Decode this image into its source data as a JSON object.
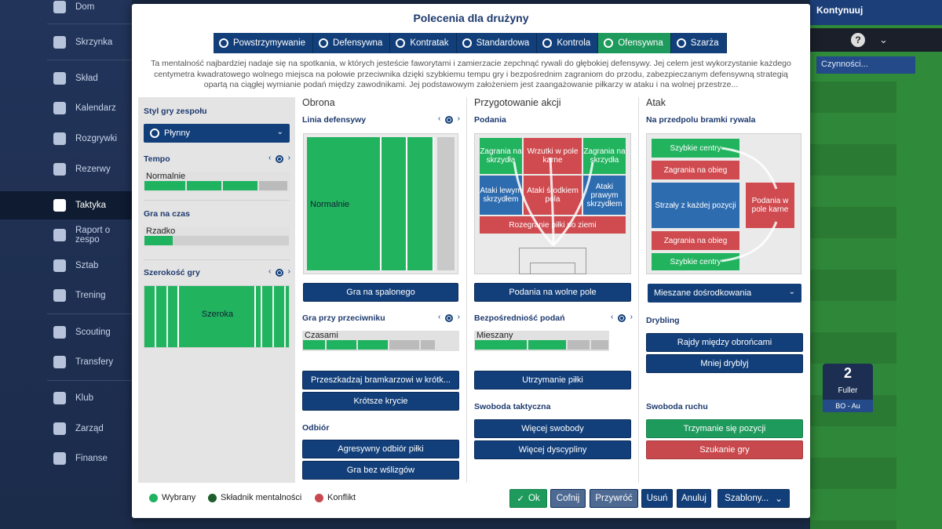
{
  "sidebar": {
    "items": [
      {
        "label": "Dom",
        "icon": "home-icon"
      },
      {
        "label": "Skrzynka",
        "icon": "inbox-icon"
      },
      {
        "label": "Skład",
        "icon": "squad-icon"
      },
      {
        "label": "Kalendarz",
        "icon": "calendar-icon"
      },
      {
        "label": "Rozgrywki",
        "icon": "trophy-icon"
      },
      {
        "label": "Rezerwy",
        "icon": "reserves-icon"
      },
      {
        "label": "Taktyka",
        "icon": "tactics-icon"
      },
      {
        "label": "Raport o zespo",
        "icon": "report-icon"
      },
      {
        "label": "Sztab",
        "icon": "staff-icon"
      },
      {
        "label": "Trening",
        "icon": "training-icon"
      },
      {
        "label": "Scouting",
        "icon": "search-icon"
      },
      {
        "label": "Transfery",
        "icon": "transfer-icon"
      },
      {
        "label": "Klub",
        "icon": "club-icon"
      },
      {
        "label": "Zarząd",
        "icon": "board-icon"
      },
      {
        "label": "Finanse",
        "icon": "finance-icon"
      }
    ],
    "active": "Taktyka"
  },
  "topbar": {
    "continue_label": "Kontynuuj",
    "help": "?",
    "actions_label": "Czynności..."
  },
  "player_card": {
    "number": "2",
    "name": "Fuller",
    "position": "BO - Au"
  },
  "modal": {
    "title": "Polecenia dla drużyny",
    "mentalities": [
      {
        "label": "Powstrzymywanie",
        "active": false
      },
      {
        "label": "Defensywna",
        "active": false
      },
      {
        "label": "Kontratak",
        "active": false
      },
      {
        "label": "Standardowa",
        "active": false
      },
      {
        "label": "Kontrola",
        "active": false
      },
      {
        "label": "Ofensywna",
        "active": true
      },
      {
        "label": "Szarża",
        "active": false
      }
    ],
    "description": "Ta mentalność najbardziej nadaje się na spotkania, w których jesteście faworytami i zamierzacie zepchnąć rywali do głębokiej defensywy. Jej celem jest wykorzystanie każdego centymetra kwadratowego wolnego miejsca na połowie przeciwnika dzięki szybkiemu tempu gry i bezpośrednim zagraniom do przodu, zabezpieczanym defensywną strategią opartą na ciągłej wymianie podań między zawodnikami. Jej podstawowym założeniem jest zaangażowanie piłkarzy w ataku i na wolnej przestrze...",
    "left": {
      "style_title": "Styl gry zespołu",
      "style_value": "Płynny",
      "tempo_title": "Tempo",
      "tempo_value": "Normalnie",
      "tempo_level": 3,
      "time_title": "Gra na czas",
      "time_value": "Rzadko",
      "time_level": 1,
      "width_title": "Szerokość gry",
      "width_value": "Szeroka"
    },
    "defense": {
      "title": "Obrona",
      "line_title": "Linia defensywy",
      "line_value": "Normalnie",
      "offside_button": "Gra na spalonego",
      "press_title": "Gra przy przeciwniku",
      "press_value": "Czasami",
      "press_level": 3,
      "press_buttons": [
        "Przeszkadzaj bramkarzowi w krótk...",
        "Krótsze krycie"
      ],
      "tackle_title": "Odbiór",
      "tackle_buttons": [
        "Agresywny odbiór piłki",
        "Gra bez wślizgów"
      ]
    },
    "buildup": {
      "title": "Przygotowanie akcji",
      "passing_title": "Podania",
      "zones": {
        "left_wing": "Zagrania na skrzydła",
        "through": "Wrzutki w pole karne",
        "right_wing": "Zagrania na skrzydła",
        "left_attack": "Ataki lewym skrzydłem",
        "center_attack": "Ataki środkiem pola",
        "right_attack": "Ataki prawym skrzydłem",
        "ground": "Rozegranie piłki po ziemi"
      },
      "space_button": "Podania na wolne pole",
      "directness_title": "Bezpośredniość podań",
      "directness_value": "Mieszany",
      "directness_level": 2,
      "retain_button": "Utrzymanie piłki",
      "freedom_title": "Swoboda taktyczna",
      "freedom_buttons": [
        "Więcej swobody",
        "Więcej dyscypliny"
      ]
    },
    "attack": {
      "title": "Atak",
      "final_third_title": "Na przedpolu bramki rywala",
      "zones": {
        "top_cross": "Szybkie centry",
        "top_overlap": "Zagrania na obieg",
        "set_pieces": "Strzały z każdej pozycji",
        "box": "Podania w pole karne",
        "bottom_overlap": "Zagrania na obieg",
        "bottom_cross": "Szybkie centry"
      },
      "cross_dropdown": "Mieszane dośrodkowania",
      "dribble_title": "Drybling",
      "dribble_buttons": [
        "Rajdy między obrońcami",
        "Mniej dryblуj"
      ],
      "movement_title": "Swoboda ruchu",
      "movement_buttons": [
        "Trzymanie się pozycji",
        "Szukanie gry"
      ]
    },
    "legend": [
      {
        "label": "Wybrany",
        "color": "#1fb25f"
      },
      {
        "label": "Składnik mentalności",
        "color": "#1d5e2b"
      },
      {
        "label": "Konflikt",
        "color": "#c8494d"
      }
    ],
    "footer": {
      "ok": "Ok",
      "undo": "Cofnij",
      "restore": "Przywróć",
      "delete": "Usuń",
      "cancel": "Anuluj",
      "templates": "Szablony..."
    }
  }
}
